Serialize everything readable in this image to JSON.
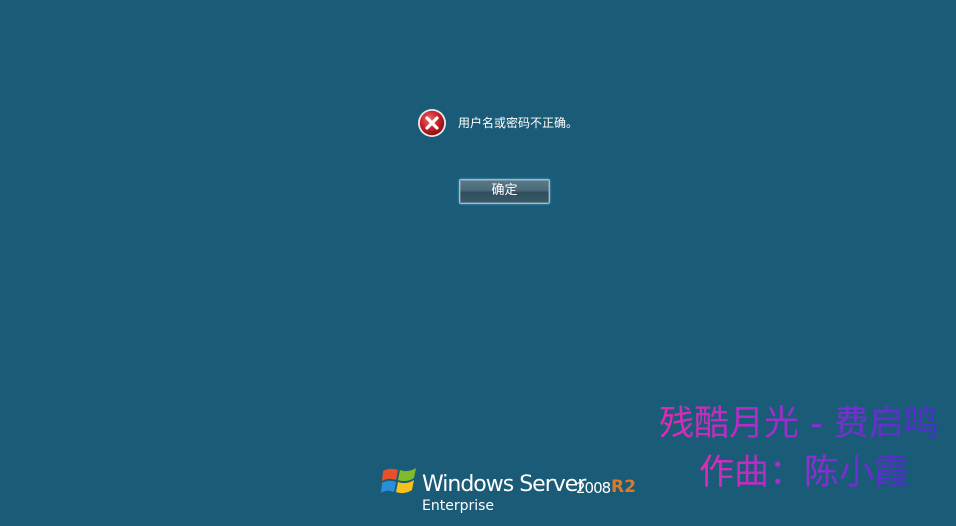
{
  "dialog": {
    "message": "用户名或密码不正确。",
    "ok_label": "确定",
    "icon": "error-icon"
  },
  "overlay": {
    "line1": "残酷月光 - 费启鸣",
    "line2": "作曲：陈小霞"
  },
  "branding": {
    "product_name": "Windows Server",
    "version": "2008",
    "release": "R2",
    "edition": "Enterprise",
    "logo": "windows-logo-icon"
  },
  "colors": {
    "background": "#1a5b78",
    "error_red": "#c8202a",
    "button_border": "#59d7ef",
    "release_orange": "#e2781f"
  }
}
